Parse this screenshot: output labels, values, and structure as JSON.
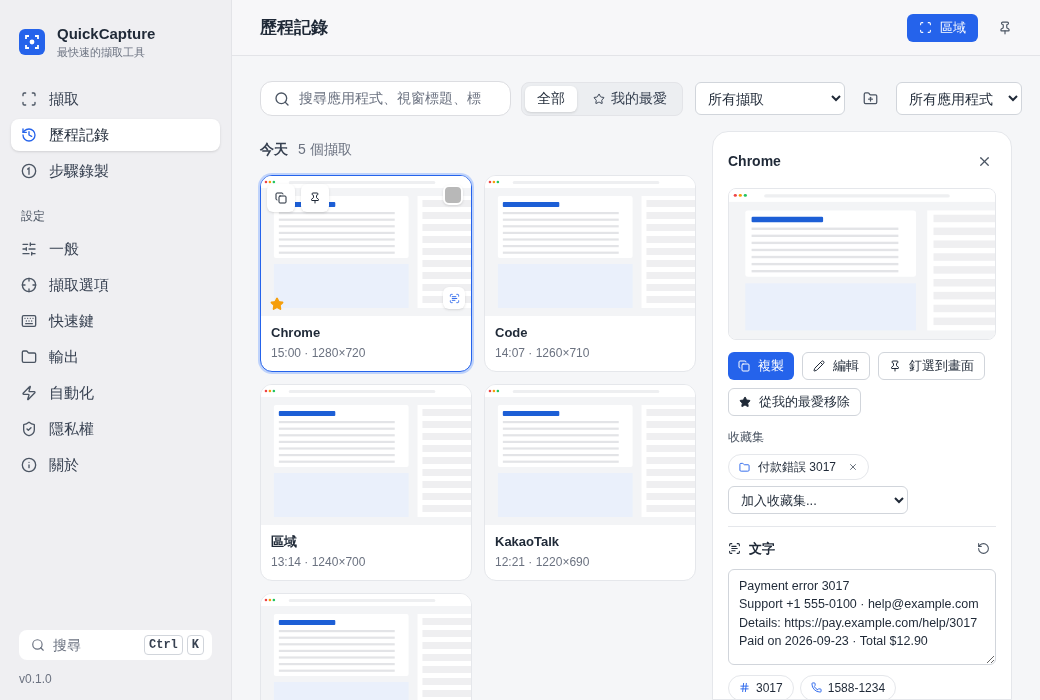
{
  "app": {
    "name": "QuickCapture",
    "tagline": "最快速的擷取工具"
  },
  "nav": [
    {
      "label": "擷取",
      "selected": false
    },
    {
      "label": "歷程記錄",
      "selected": true
    },
    {
      "label": "步驟錄製",
      "selected": false
    }
  ],
  "settings_heading": "設定",
  "settings_nav": [
    {
      "label": "一般",
      "selected": false
    },
    {
      "label": "擷取選項",
      "selected": false
    },
    {
      "label": "快速鍵",
      "selected": false
    },
    {
      "label": "輸出",
      "selected": false
    },
    {
      "label": "自動化",
      "selected": false
    },
    {
      "label": "隱私權",
      "selected": false
    },
    {
      "label": "關於",
      "selected": false
    }
  ],
  "sidebar_search": {
    "placeholder": "搜尋",
    "keys": [
      "Ctrl",
      "K"
    ]
  },
  "version": "v0.1.0",
  "header": {
    "title": "歷程記錄",
    "region_button": "區域"
  },
  "toolbar": {
    "search_placeholder": "搜尋應用程式、視窗標題、標",
    "filters": [
      {
        "label": "全部",
        "selected": true
      },
      {
        "label": "我的最愛",
        "selected": false
      }
    ],
    "capture_select": "所有擷取",
    "app_select": "所有應用程式"
  },
  "group": {
    "label": "今天",
    "count": "5 個擷取"
  },
  "captures": [
    {
      "title": "Chrome",
      "meta": "15:00 · 1280×720",
      "selected": true,
      "hovered": true,
      "favorite": true
    },
    {
      "title": "Code",
      "meta": "14:07 · 1260×710",
      "selected": false,
      "hovered": false,
      "favorite": false
    },
    {
      "title": "區域",
      "meta": "13:14 · 1240×700",
      "selected": false,
      "hovered": false,
      "favorite": false
    },
    {
      "title": "KakaoTalk",
      "meta": "12:21 · 1220×690",
      "selected": false,
      "hovered": false,
      "favorite": false
    },
    {
      "selected": false
    }
  ],
  "detail": {
    "title": "Chrome",
    "actions": [
      {
        "label": "複製",
        "primary": true
      },
      {
        "label": "編輯",
        "primary": false
      },
      {
        "label": "釘選到畫面",
        "primary": false
      },
      {
        "label": "從我的最愛移除",
        "primary": false
      }
    ],
    "collections_label": "收藏集",
    "collections": [
      "付款錯誤 3017"
    ],
    "add_collection": "加入收藏集...",
    "text_heading": "文字",
    "text": "Payment error 3017\nSupport +1 555-0100 · help@example.com\nDetails: https://pay.example.com/help/3017\nPaid on 2026-09-23 · Total $12.90",
    "chips": [
      {
        "kind": "number",
        "label": "3017"
      },
      {
        "kind": "phone",
        "label": "1588-1234"
      }
    ]
  }
}
